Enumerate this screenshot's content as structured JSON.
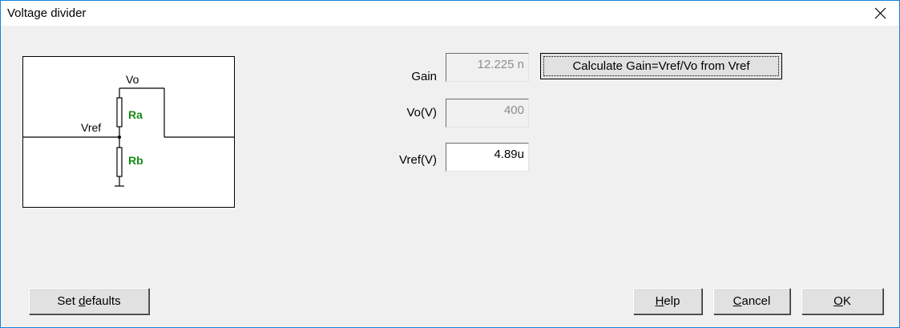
{
  "window": {
    "title": "Voltage divider"
  },
  "diagram": {
    "vo_label": "Vo",
    "vref_label": "Vref",
    "ra_label": "Ra",
    "rb_label": "Rb"
  },
  "fields": {
    "gain": {
      "label": "Gain",
      "value": "12.225 n"
    },
    "vo": {
      "label": "Vo(V)",
      "value": "400"
    },
    "vref": {
      "label": "Vref(V)",
      "value": "4.89u"
    }
  },
  "buttons": {
    "calculate": "Calculate Gain=Vref/Vo from Vref",
    "set_defaults_pre": "Set ",
    "set_defaults_key": "d",
    "set_defaults_post": "efaults",
    "help_key": "H",
    "help_post": "elp",
    "cancel_key": "C",
    "cancel_post": "ancel",
    "ok_key": "O",
    "ok_post": "K"
  }
}
